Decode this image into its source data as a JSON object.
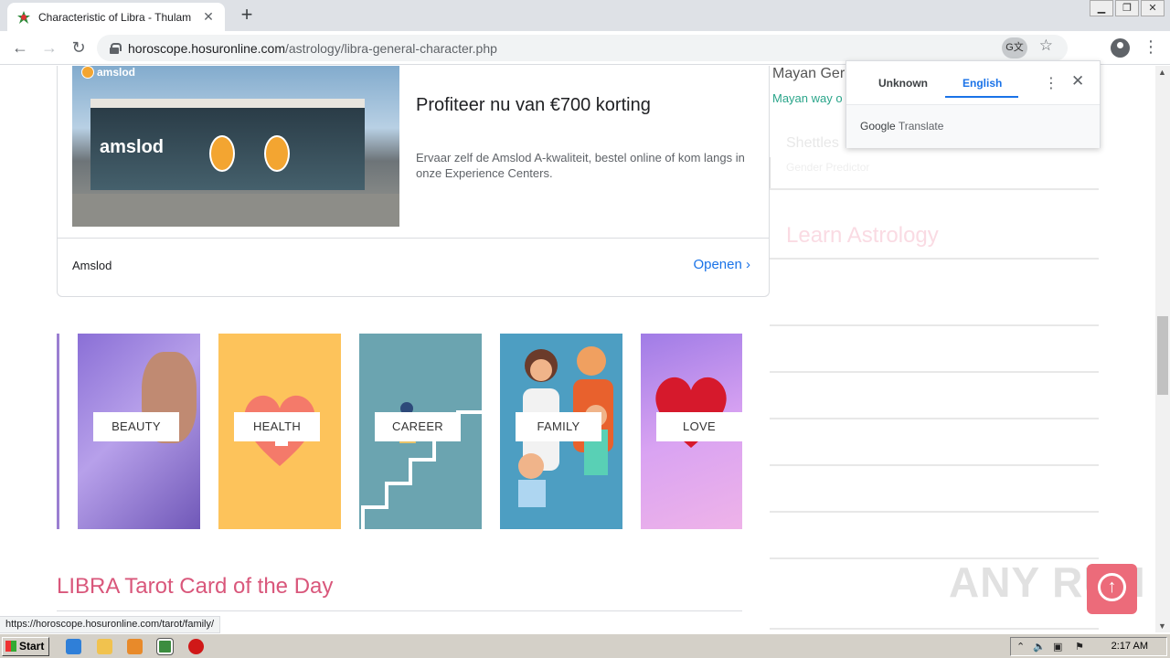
{
  "browser": {
    "tab_title": "Characteristic of Libra - Thulam",
    "tab_close": "✕",
    "new_tab": "+",
    "url_host": "horoscope.hosuronline.com",
    "url_path": "/astrology/libra-general-character.php",
    "back": "←",
    "forward": "→",
    "reload": "↻",
    "star": "☆",
    "menu": "⋮",
    "window_controls": [
      "▁",
      "❐",
      "✕"
    ],
    "translate_icon": "G文"
  },
  "ad": {
    "logo_text": "amslod",
    "building_brand": "amslod",
    "headline": "Profiteer nu van €700 korting",
    "description": "Ervaar zelf de Amslod A-kwaliteit, bestel online of kom langs in onze Experience Centers.",
    "advertiser": "Amslod",
    "cta": "Openen ›"
  },
  "categories": [
    {
      "label": "BEAUTY"
    },
    {
      "label": "HEALTH"
    },
    {
      "label": "CAREER"
    },
    {
      "label": "FAMILY"
    },
    {
      "label": "LOVE"
    }
  ],
  "tarot_heading": "LIBRA Tarot Card of the Day",
  "sidebar": {
    "item1_title": "Mayan Ger",
    "item1_sub": "Mayan way o",
    "item2_title": "Shettles",
    "item2_sub": "Gender Predictor",
    "learn_heading": "Learn Astrology"
  },
  "translate_popup": {
    "tab_source": "Unknown",
    "tab_target": "English",
    "more": "⋮",
    "close": "✕",
    "brand_google": "Google",
    "brand_translate": "Translate"
  },
  "status_url": "https://horoscope.hosuronline.com/tarot/family/",
  "scroll_top_icon": "↑",
  "watermark": "ANY RUN",
  "taskbar": {
    "start": "Start",
    "clock": "2:17 AM"
  },
  "colors": {
    "accent_pink": "#d9577b",
    "link_blue": "#1a73e8",
    "teal": "#2aa58a"
  }
}
